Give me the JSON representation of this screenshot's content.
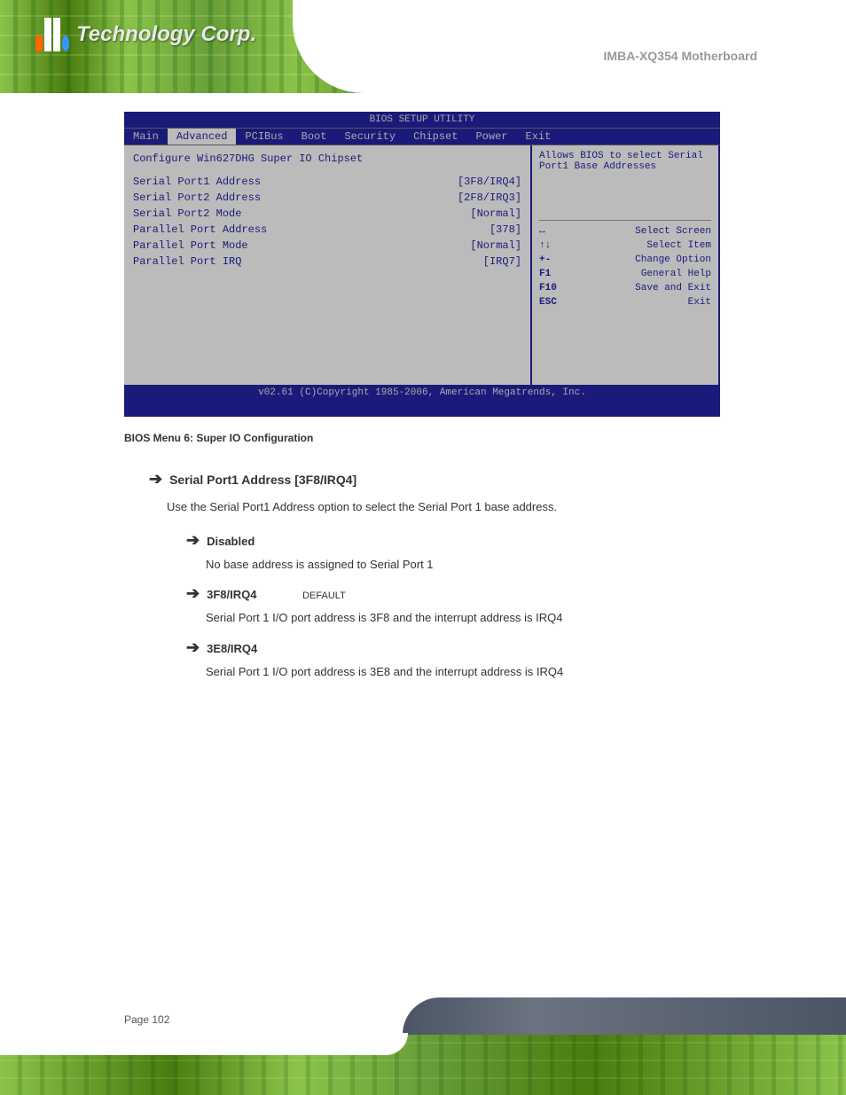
{
  "header": {
    "brand": "Technology Corp.",
    "doc_title": "IMBA-XQ354 Motherboard"
  },
  "bios": {
    "title": "BIOS SETUP UTILITY",
    "tabs": [
      "Main",
      "Advanced",
      "PCIBus",
      "Boot",
      "Security",
      "Chipset",
      "Power",
      "Exit"
    ],
    "active_tab": "Advanced",
    "left_rows": [
      {
        "label": "Configure Win627DHG Super IO Chipset",
        "value": ""
      },
      {
        "label": "Serial Port1 Address",
        "value": "[3F8/IRQ4]"
      },
      {
        "label": "Serial Port2 Address",
        "value": "[2F8/IRQ3]"
      },
      {
        "label": "   Serial Port2 Mode",
        "value": "[Normal]"
      },
      {
        "label": "Parallel Port Address",
        "value": "[378]"
      },
      {
        "label": "   Parallel Port Mode",
        "value": "[Normal]"
      },
      {
        "label": "   Parallel Port IRQ",
        "value": "[IRQ7]"
      }
    ],
    "right_hint": "Allows BIOS to select Serial Port1 Base Addresses",
    "nav": [
      {
        "arrow": "↔",
        "text": "Select Screen"
      },
      {
        "arrow": "↑↓",
        "text": "Select Item"
      },
      {
        "arrow": "+-",
        "text": "Change Option"
      },
      {
        "arrow": "F1",
        "text": "General Help"
      },
      {
        "arrow": "F10",
        "text": "Save and Exit"
      },
      {
        "arrow": "ESC",
        "text": "Exit"
      }
    ],
    "footer": "v02.61  (C)Copyright 1985-2006, American Megatrends, Inc."
  },
  "caption": "BIOS Menu 6: Super IO Configuration",
  "option1": {
    "name": "Serial Port1 Address [3F8/IRQ4]",
    "desc": "Use the Serial Port1 Address option to select the Serial Port 1 base address.",
    "sub": [
      {
        "label": "Disabled",
        "def": "",
        "desc": "No base address is assigned to Serial Port 1"
      },
      {
        "label": "3F8/IRQ4",
        "def": "DEFAULT",
        "desc": "Serial Port 1 I/O port address is 3F8 and the interrupt address is IRQ4"
      },
      {
        "label": "3E8/IRQ4",
        "def": "",
        "desc": "Serial Port 1 I/O port address is 3E8 and the interrupt address is IRQ4"
      }
    ]
  },
  "page_number": "Page 102"
}
